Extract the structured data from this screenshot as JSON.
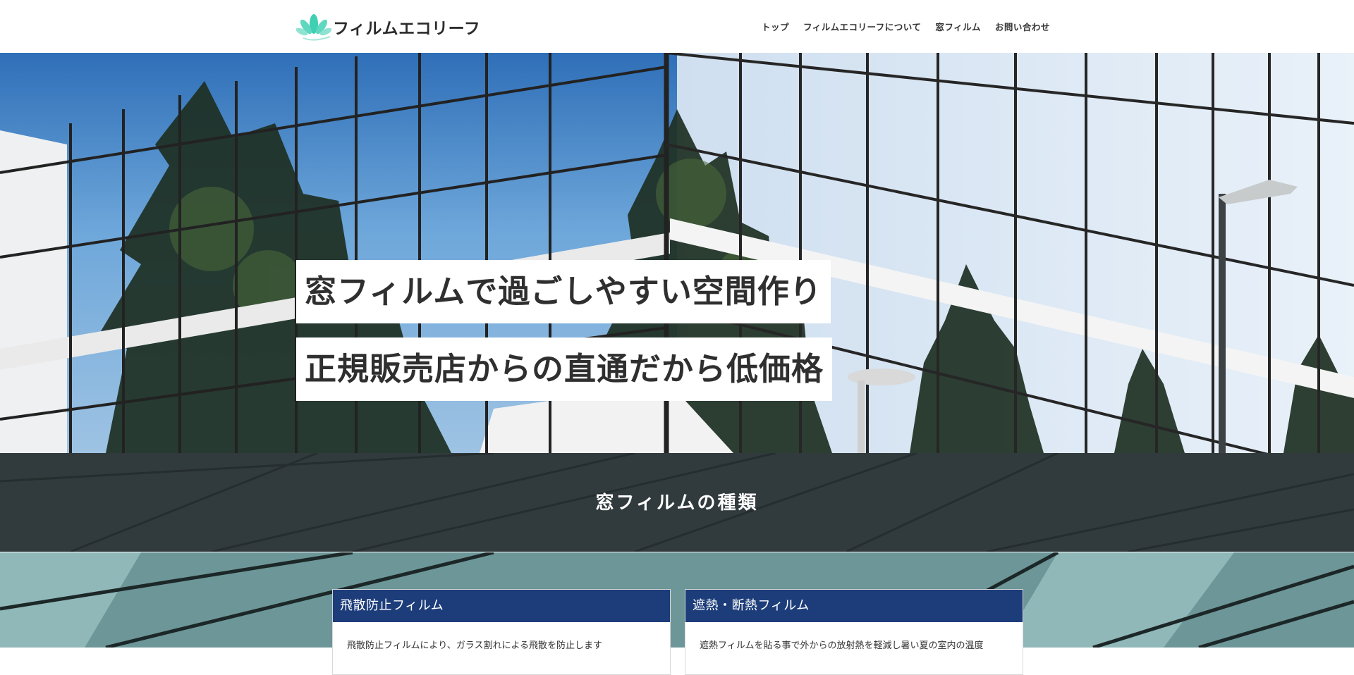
{
  "header": {
    "logo_text": "フィルムエコリーフ",
    "nav": [
      {
        "label": "トップ"
      },
      {
        "label": "フィルムエコリーフについて"
      },
      {
        "label": "窓フィルム"
      },
      {
        "label": "お問い合わせ"
      }
    ]
  },
  "hero": {
    "line1": "窓フィルムで過ごしやすい空間作り",
    "line2": "正規販売店からの直通だから低価格"
  },
  "section": {
    "title": "窓フィルムの種類"
  },
  "cards": [
    {
      "title": "飛散防止フィルム",
      "text": "飛散防止フィルムにより、ガラス割れによる飛散を防止します"
    },
    {
      "title": "遮熱・断熱フィルム",
      "text": "遮熱フィルムを貼る事で外からの放射熱を軽減し暑い夏の室内の温度"
    }
  ],
  "colors": {
    "card_header": "#1d3d7a",
    "logo_accent": "#3fcfb2"
  }
}
